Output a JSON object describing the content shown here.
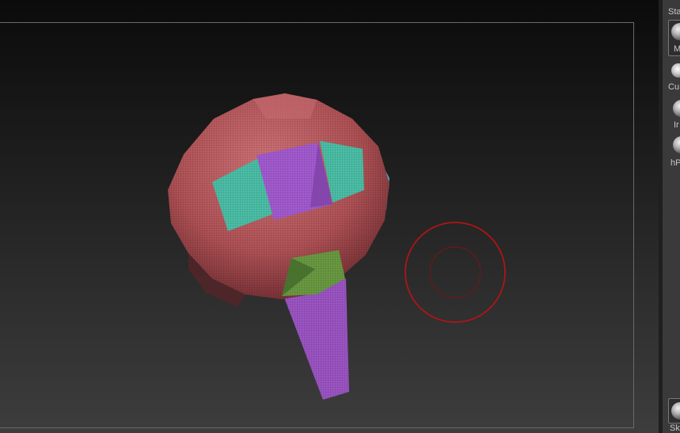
{
  "viewport": {
    "name": "3D canvas",
    "brush_cursor": {
      "outer_color": "#b01515",
      "inner_color": "#7a1515"
    }
  },
  "shelf": {
    "items": [
      {
        "label": "Sta",
        "icon": "standard-brush-icon"
      },
      {
        "label": "M",
        "icon": "material-icon"
      },
      {
        "label": "Cu",
        "icon": "curve-brush-icon"
      },
      {
        "label": "Ir",
        "icon": "insert-brush-icon"
      },
      {
        "label": "hP",
        "icon": "hpolish-brush-icon"
      },
      {
        "label": "Sk",
        "icon": "skin-shade-material-icon"
      }
    ]
  },
  "colors": {
    "polygroup_red": "#b5595c",
    "polygroup_teal": "#4fbfaa",
    "polygroup_purple": "#a85ad0",
    "polygroup_green": "#6f9a45",
    "polygroup_blue": "#5ab6d6"
  }
}
